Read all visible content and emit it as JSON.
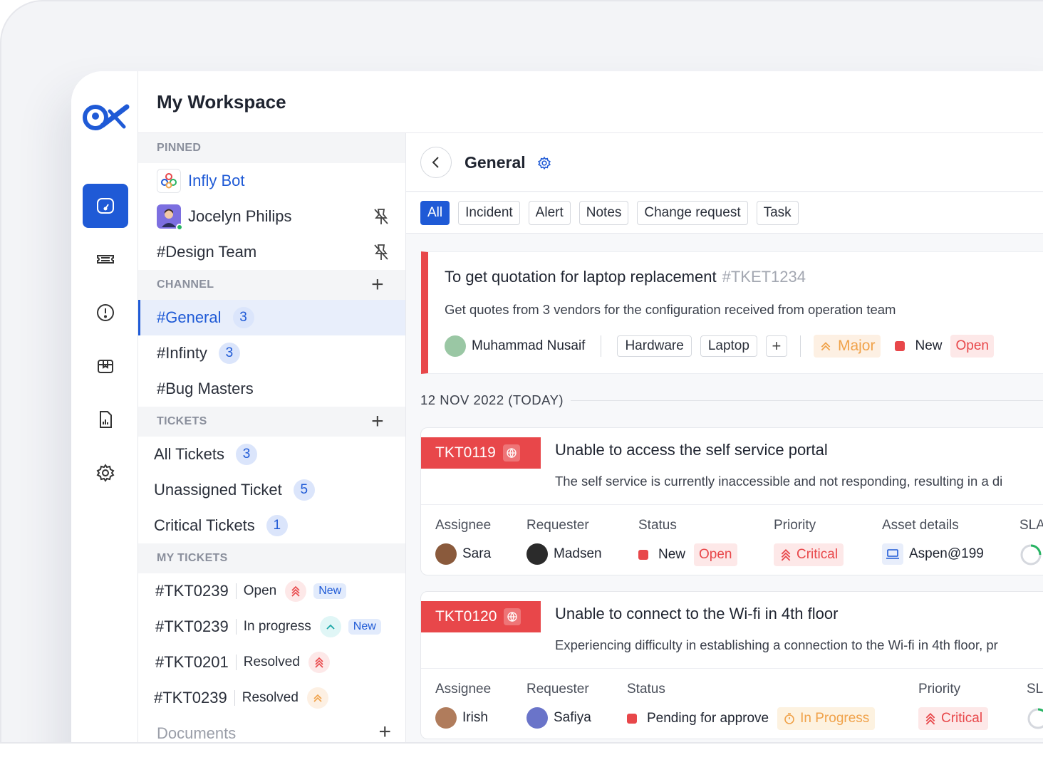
{
  "workspace": {
    "title": "My Workspace"
  },
  "nav": {
    "items": [
      {
        "name": "dashboard",
        "icon": "speedometer-icon",
        "active": true
      },
      {
        "name": "tickets",
        "icon": "ticket-icon"
      },
      {
        "name": "alerts",
        "icon": "alert-circle-icon"
      },
      {
        "name": "assets",
        "icon": "box-icon"
      },
      {
        "name": "reports",
        "icon": "report-file-icon"
      },
      {
        "name": "settings",
        "icon": "gear-icon"
      }
    ]
  },
  "sidebar": {
    "pinned_label": "PINNED",
    "pinned": [
      {
        "label": "Infly Bot",
        "type": "bot"
      },
      {
        "label": "Jocelyn Philips",
        "type": "user"
      },
      {
        "label": "#Design Team",
        "type": "channel"
      }
    ],
    "channel_label": "CHANNEL",
    "channels": [
      {
        "label": "#General",
        "count": "3"
      },
      {
        "label": "#Infinty",
        "count": "3"
      },
      {
        "label": "#Bug Masters"
      }
    ],
    "tickets_label": "TICKETS",
    "tickets": [
      {
        "label": "All Tickets",
        "count": "3"
      },
      {
        "label": "Unassigned Ticket",
        "count": "5"
      },
      {
        "label": "Critical Tickets",
        "count": "1"
      }
    ],
    "my_tickets_label": "MY TICKETS",
    "my_tickets": [
      {
        "id": "#TKT0239",
        "status": "Open",
        "badge": "New",
        "priority": "critical"
      },
      {
        "id": "#TKT0239",
        "status": "In progress",
        "badge": "New",
        "priority": "low"
      },
      {
        "id": "#TKT0201",
        "status": "Resolved",
        "priority": "critical"
      },
      {
        "id": "#TKT0239",
        "status": "Resolved",
        "priority": "major"
      }
    ],
    "documents_label": "Documents"
  },
  "channel": {
    "title": "General",
    "tabs": [
      "All",
      "Incident",
      "Alert",
      "Notes",
      "Change request",
      "Task"
    ],
    "featured": {
      "title": "To get quotation for laptop replacement",
      "code": "#TKET1234",
      "description": "Get quotes from 3 vendors for the configuration received from operation team",
      "owner": "Muhammad Nusaif",
      "tags": [
        "Hardware",
        "Laptop"
      ],
      "priority": "Major",
      "state": "New",
      "status": "Open"
    },
    "date_label": "12 NOV 2022 (TODAY)",
    "tickets": [
      {
        "id": "TKT0119",
        "title": "Unable to access the self service portal",
        "description": "The self service is currently inaccessible and not responding, resulting in a di",
        "headers": {
          "assignee": "Assignee",
          "requester": "Requester",
          "status": "Status",
          "priority": "Priority",
          "asset": "Asset details",
          "sla": "SLA"
        },
        "assignee": "Sara",
        "requester": "Madsen",
        "status": "New",
        "status_pill": "Open",
        "priority": "Critical",
        "asset": "Aspen@199"
      },
      {
        "id": "TKT0120",
        "title": "Unable to connect to the Wi-fi in 4th floor",
        "description": "Experiencing difficulty in establishing a connection to the Wi-fi in 4th floor, pr",
        "headers": {
          "assignee": "Assignee",
          "requester": "Requester",
          "status": "Status",
          "priority": "Priority",
          "sla": "SL"
        },
        "assignee": "Irish",
        "requester": "Safiya",
        "status": "Pending for approve",
        "status_pill": "In Progress",
        "priority": "Critical"
      }
    ]
  },
  "colors": {
    "accent": "#1f5ad6",
    "critical": "#e8474a",
    "major": "#f0a24a"
  }
}
